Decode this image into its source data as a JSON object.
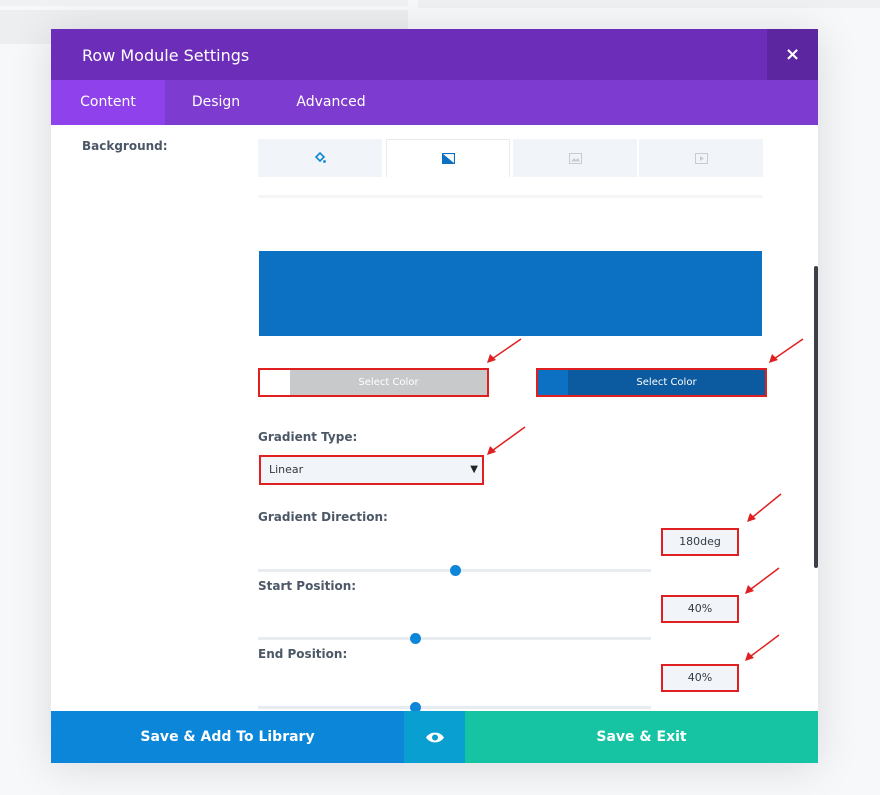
{
  "modal": {
    "title": "Row Module Settings",
    "close_symbol": "×",
    "tabs": [
      {
        "label": "Content",
        "active": true
      },
      {
        "label": "Design",
        "active": false
      },
      {
        "label": "Advanced",
        "active": false
      }
    ]
  },
  "background": {
    "label": "Background:",
    "type_tabs": [
      {
        "icon": "paint-bucket-icon",
        "active": false
      },
      {
        "icon": "gradient-icon",
        "active": true
      },
      {
        "icon": "image-icon",
        "active": false
      },
      {
        "icon": "video-icon",
        "active": false
      }
    ],
    "preview_color": "#0c71c3",
    "color_1": {
      "label": "Select Color",
      "swatch": "#ffffff"
    },
    "color_2": {
      "label": "Select Color",
      "swatch": "#0c71c3"
    }
  },
  "gradient": {
    "type_label": "Gradient Type:",
    "type_value": "Linear",
    "caret": "▼",
    "direction": {
      "label": "Gradient Direction:",
      "value": "180deg",
      "degrees": 180
    },
    "start": {
      "label": "Start Position:",
      "value": "40%",
      "percent": 40
    },
    "end": {
      "label": "End Position:",
      "value": "40%",
      "percent": 40
    }
  },
  "footer": {
    "save_library_label": "Save & Add To Library",
    "preview_icon": "eye-icon",
    "save_exit_label": "Save & Exit"
  },
  "colors": {
    "title_bar": "#6c2eb9",
    "tabs_bar": "#7e3bd0",
    "highlight": "#e02020",
    "save_library": "#0c86d8",
    "save_exit": "#16c4a4"
  }
}
